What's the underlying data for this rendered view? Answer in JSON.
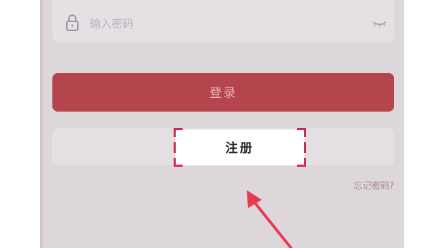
{
  "password": {
    "placeholder": "输入密码",
    "value": "",
    "lock_icon": "lock-icon",
    "visibility_icon": "eye-closed-icon"
  },
  "login": {
    "label": "登录"
  },
  "register": {
    "label": "注册"
  },
  "forgot_password": {
    "label": "忘记密码?"
  },
  "annotation": {
    "type": "arrow",
    "color": "#e8394f",
    "points_to": "register-button"
  },
  "colors": {
    "primary": "#b5454c",
    "highlight": "#d02a4a",
    "background": "#ddd7dc"
  }
}
